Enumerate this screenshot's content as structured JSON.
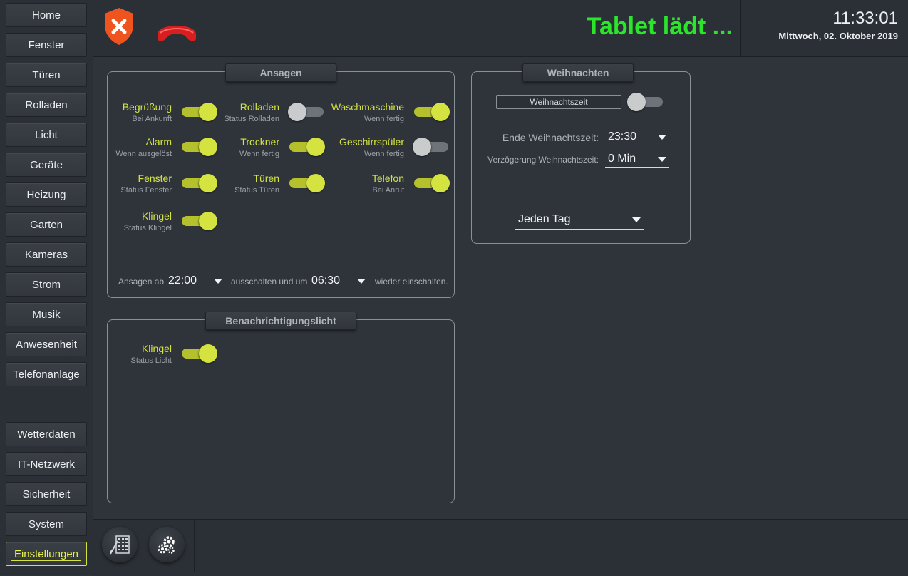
{
  "sidebar": {
    "items": [
      {
        "label": "Home"
      },
      {
        "label": "Fenster"
      },
      {
        "label": "Türen"
      },
      {
        "label": "Rolladen"
      },
      {
        "label": "Licht"
      },
      {
        "label": "Geräte"
      },
      {
        "label": "Heizung"
      },
      {
        "label": "Garten"
      },
      {
        "label": "Kameras"
      },
      {
        "label": "Strom"
      },
      {
        "label": "Musik"
      },
      {
        "label": "Anwesenheit"
      },
      {
        "label": "Telefonanlage"
      }
    ],
    "bottom_items": [
      {
        "label": "Wetterdaten"
      },
      {
        "label": "IT-Netzwerk"
      },
      {
        "label": "Sicherheit"
      },
      {
        "label": "System"
      },
      {
        "label": "Einstellungen"
      }
    ],
    "active": "Einstellungen"
  },
  "header": {
    "icons": [
      "shield-x-icon",
      "phone-hangup-icon"
    ],
    "status_text": "Tablet lädt ...",
    "status_color": "#2ae52a",
    "time": "11:33:01",
    "date": "Mittwoch, 02. Oktober 2019"
  },
  "ansagen": {
    "title": "Ansagen",
    "toggles": [
      {
        "title": "Begrüßung",
        "sub": "Bei Ankunft",
        "on": true
      },
      {
        "title": "Rolladen",
        "sub": "Status Rolladen",
        "on": false
      },
      {
        "title": "Waschmaschine",
        "sub": "Wenn fertig",
        "on": true
      },
      {
        "title": "Alarm",
        "sub": "Wenn ausgelöst",
        "on": true
      },
      {
        "title": "Trockner",
        "sub": "Wenn fertig",
        "on": true
      },
      {
        "title": "Geschirrspüler",
        "sub": "Wenn fertig",
        "on": false
      },
      {
        "title": "Fenster",
        "sub": "Status Fenster",
        "on": true
      },
      {
        "title": "Türen",
        "sub": "Status Türen",
        "on": true
      },
      {
        "title": "Telefon",
        "sub": "Bei Anruf",
        "on": true
      },
      {
        "title": "Klingel",
        "sub": "Status Klingel",
        "on": true
      }
    ],
    "schedule": {
      "prefix": "Ansagen ab",
      "from": "22:00",
      "middle": "ausschalten und um",
      "to": "06:30",
      "suffix": "wieder einschalten."
    }
  },
  "benachrichtigung": {
    "title": "Benachrichtigungslicht",
    "toggles": [
      {
        "title": "Klingel",
        "sub": "Status Licht",
        "on": true
      }
    ]
  },
  "weihnachten": {
    "title": "Weihnachten",
    "mode_label": "Weihnachtszeit",
    "mode_on": false,
    "end_label": "Ende Weihnachtszeit:",
    "end_value": "23:30",
    "delay_label": "Verzögerung Weihnachtszeit:",
    "delay_value": "0 Min",
    "days_value": "Jeden Tag"
  },
  "footer": {
    "icons": [
      "keypad-icon",
      "gears-icon"
    ]
  },
  "colors": {
    "accent": "#d4e340",
    "background": "#2f343b"
  }
}
